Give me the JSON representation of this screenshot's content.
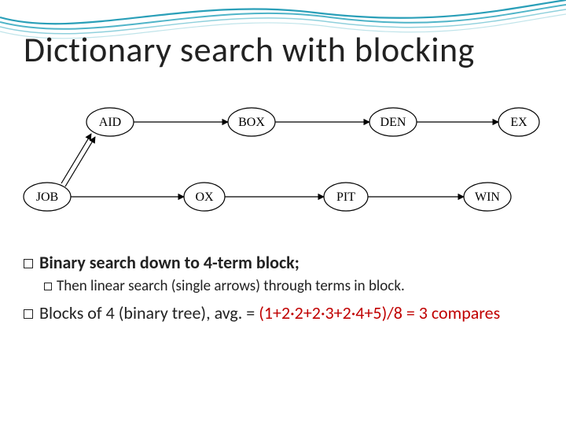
{
  "title": "Dictionary search with blocking",
  "diagram": {
    "row1": [
      "AID",
      "BOX",
      "DEN",
      "EX"
    ],
    "row2": [
      "JOB",
      "OX",
      "PIT",
      "WIN"
    ],
    "binary_edge": {
      "from": "JOB",
      "to": "AID",
      "style": "double"
    },
    "linear_edges_row1": [
      [
        "AID",
        "BOX"
      ],
      [
        "BOX",
        "DEN"
      ],
      [
        "DEN",
        "EX"
      ]
    ],
    "linear_edges_row2": [
      [
        "JOB",
        "OX"
      ],
      [
        "OX",
        "PIT"
      ],
      [
        "PIT",
        "WIN"
      ]
    ]
  },
  "bullets": {
    "b1": "Binary search down to 4-term block;",
    "b1a": "Then linear search (single arrows) through terms in block.",
    "b2_prefix": "Blocks of 4 (binary tree), avg. = ",
    "b2_formula": "(1+2·2+2·3+2·4+5)/8 = 3 compares"
  }
}
